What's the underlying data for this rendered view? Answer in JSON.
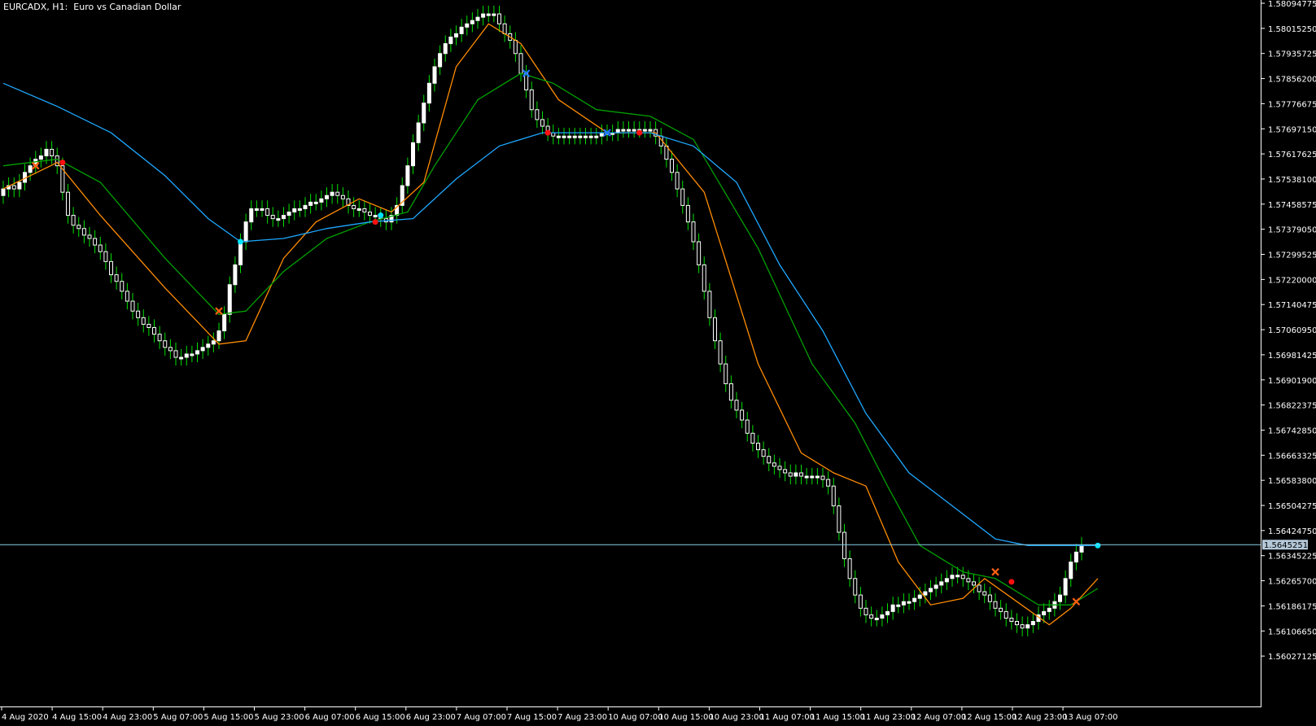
{
  "header": {
    "symbol_line": "EURCADX, H1:  Euro vs Canadian Dollar"
  },
  "colors": {
    "background": "#000000",
    "axis": "#ffffff",
    "candle_body": "#ffffff",
    "candle_wick": "#00e000",
    "bid_line": "#8ad0e8",
    "price_box": "#b4c8d8",
    "ma_fast": "#ff8c00",
    "ma_mid": "#00a000",
    "ma_slow": "#1ea8ff",
    "marker_red": "#ff1010",
    "marker_cyan": "#00e5ff",
    "marker_orange_x": "#ff6010",
    "marker_blue_x": "#1e78ff"
  },
  "chart_data": {
    "type": "candlestick",
    "title": "EURCADX, H1:  Euro vs Canadian Dollar",
    "xlabel": "",
    "ylabel": "",
    "ylim": [
      1.5596,
      1.581
    ],
    "grid": false,
    "y_ticks": [
      "1.58094775",
      "1.58015250",
      "1.57935725",
      "1.57856200",
      "1.57776675",
      "1.57697150",
      "1.57617625",
      "1.57538100",
      "1.57458575",
      "1.57379050",
      "1.57299525",
      "1.57220000",
      "1.57140475",
      "1.57060950",
      "1.56981425",
      "1.56901900",
      "1.56822375",
      "1.56742850",
      "1.56663325",
      "1.56583800",
      "1.56504275",
      "1.56424750",
      "1.56345225",
      "1.56265700",
      "1.56186175",
      "1.56106650",
      "1.56027125"
    ],
    "x_ticks": [
      "4 Aug 2020",
      "4 Aug 15:00",
      "4 Aug 23:00",
      "5 Aug 07:00",
      "5 Aug 15:00",
      "5 Aug 23:00",
      "6 Aug 07:00",
      "6 Aug 15:00",
      "6 Aug 23:00",
      "7 Aug 07:00",
      "7 Aug 15:00",
      "7 Aug 23:00",
      "10 Aug 07:00",
      "10 Aug 15:00",
      "10 Aug 23:00",
      "11 Aug 07:00",
      "11 Aug 15:00",
      "11 Aug 23:00",
      "12 Aug 07:00",
      "12 Aug 15:00",
      "12 Aug 23:00",
      "13 Aug 07:00"
    ],
    "current_price": 1.56452515,
    "current_price_label": "1.56452515",
    "close": [
      1.5753,
      1.5754,
      1.5753,
      1.5755,
      1.5758,
      1.576,
      1.5762,
      1.5763,
      1.5765,
      1.5763,
      1.576,
      1.5752,
      1.5745,
      1.5742,
      1.5741,
      1.5739,
      1.5738,
      1.5736,
      1.5734,
      1.5731,
      1.5727,
      1.5725,
      1.5722,
      1.5719,
      1.5716,
      1.5714,
      1.5712,
      1.5711,
      1.5709,
      1.5707,
      1.5705,
      1.5704,
      1.5702,
      1.5702,
      1.5703,
      1.5703,
      1.5704,
      1.5705,
      1.5706,
      1.5707,
      1.571,
      1.5715,
      1.5724,
      1.573,
      1.5737,
      1.5743,
      1.5747,
      1.5747,
      1.5747,
      1.5745,
      1.5744,
      1.5744,
      1.5745,
      1.5746,
      1.5747,
      1.5747,
      1.5748,
      1.5749,
      1.5749,
      1.575,
      1.5751,
      1.5752,
      1.5751,
      1.575,
      1.5748,
      1.5747,
      1.5747,
      1.5746,
      1.5745,
      1.5745,
      1.5744,
      1.5743,
      1.5745,
      1.5748,
      1.5754,
      1.576,
      1.5767,
      1.5773,
      1.5779,
      1.5785,
      1.579,
      1.5794,
      1.5797,
      1.5799,
      1.58,
      1.5802,
      1.5803,
      1.5804,
      1.5805,
      1.5806,
      1.5806,
      1.5806,
      1.5803,
      1.58,
      1.5798,
      1.5794,
      1.5788,
      1.5783,
      1.5777,
      1.5774,
      1.5772,
      1.577,
      1.5769,
      1.5769,
      1.5769,
      1.5769,
      1.5769,
      1.5769,
      1.5769,
      1.5769,
      1.5769,
      1.577,
      1.577,
      1.577,
      1.5771,
      1.5771,
      1.5771,
      1.5771,
      1.5771,
      1.5771,
      1.5771,
      1.5769,
      1.5766,
      1.5762,
      1.5758,
      1.5753,
      1.5748,
      1.5743,
      1.5737,
      1.573,
      1.5722,
      1.5714,
      1.5707,
      1.57,
      1.5694,
      1.5689,
      1.5686,
      1.5683,
      1.5679,
      1.5676,
      1.5674,
      1.5672,
      1.567,
      1.5669,
      1.5668,
      1.5667,
      1.5666,
      1.5667,
      1.5666,
      1.5666,
      1.5666,
      1.5666,
      1.5665,
      1.5663,
      1.5657,
      1.5649,
      1.5641,
      1.5635,
      1.563,
      1.5626,
      1.5624,
      1.5623,
      1.5623,
      1.5624,
      1.5625,
      1.5627,
      1.5627,
      1.5628,
      1.5628,
      1.5629,
      1.563,
      1.5631,
      1.5632,
      1.5633,
      1.5634,
      1.5635,
      1.5636,
      1.5636,
      1.5635,
      1.5634,
      1.5633,
      1.5631,
      1.563,
      1.5628,
      1.5626,
      1.5625,
      1.5623,
      1.5622,
      1.5621,
      1.562,
      1.5621,
      1.5622,
      1.5624,
      1.5625,
      1.5626,
      1.5628,
      1.563,
      1.5635,
      1.564,
      1.5643,
      1.5645
    ],
    "series": [
      {
        "type": "line",
        "color": "#ff8c00",
        "points": [
          [
            0,
            1.5753
          ],
          [
            10,
            1.5761
          ],
          [
            18,
            1.5745
          ],
          [
            30,
            1.5723
          ],
          [
            40,
            1.5706
          ],
          [
            45,
            1.5707
          ],
          [
            52,
            1.5732
          ],
          [
            58,
            1.5743
          ],
          [
            66,
            1.575
          ],
          [
            72,
            1.5746
          ],
          [
            78,
            1.5755
          ],
          [
            84,
            1.579
          ],
          [
            90,
            1.5803
          ],
          [
            96,
            1.5797
          ],
          [
            103,
            1.578
          ],
          [
            112,
            1.577
          ],
          [
            121,
            1.577
          ],
          [
            130,
            1.5752
          ],
          [
            140,
            1.57
          ],
          [
            148,
            1.5673
          ],
          [
            154,
            1.5667
          ],
          [
            160,
            1.5663
          ],
          [
            166,
            1.564
          ],
          [
            172,
            1.5627
          ],
          [
            178,
            1.5629
          ],
          [
            182,
            1.5635
          ],
          [
            188,
            1.5628
          ],
          [
            194,
            1.5621
          ],
          [
            198,
            1.5626
          ],
          [
            203,
            1.5635
          ]
        ]
      },
      {
        "type": "line",
        "color": "#00a000",
        "points": [
          [
            0,
            1.576
          ],
          [
            10,
            1.5762
          ],
          [
            18,
            1.5755
          ],
          [
            30,
            1.5732
          ],
          [
            40,
            1.5715
          ],
          [
            45,
            1.5716
          ],
          [
            52,
            1.5728
          ],
          [
            60,
            1.5738
          ],
          [
            68,
            1.5743
          ],
          [
            75,
            1.5746
          ],
          [
            80,
            1.576
          ],
          [
            88,
            1.578
          ],
          [
            96,
            1.5788
          ],
          [
            102,
            1.5785
          ],
          [
            110,
            1.5777
          ],
          [
            120,
            1.5775
          ],
          [
            128,
            1.5768
          ],
          [
            140,
            1.5735
          ],
          [
            150,
            1.57
          ],
          [
            158,
            1.5682
          ],
          [
            164,
            1.5663
          ],
          [
            170,
            1.5645
          ],
          [
            178,
            1.5637
          ],
          [
            184,
            1.5635
          ],
          [
            192,
            1.5627
          ],
          [
            198,
            1.5627
          ],
          [
            203,
            1.5632
          ]
        ]
      },
      {
        "type": "line",
        "color": "#1ea8ff",
        "points": [
          [
            0,
            1.5785
          ],
          [
            10,
            1.5778
          ],
          [
            20,
            1.577
          ],
          [
            30,
            1.5757
          ],
          [
            38,
            1.5744
          ],
          [
            44,
            1.5737
          ],
          [
            52,
            1.5738
          ],
          [
            60,
            1.5741
          ],
          [
            68,
            1.5743
          ],
          [
            76,
            1.5744
          ],
          [
            84,
            1.5756
          ],
          [
            92,
            1.5766
          ],
          [
            100,
            1.577
          ],
          [
            110,
            1.577
          ],
          [
            120,
            1.577
          ],
          [
            128,
            1.5766
          ],
          [
            136,
            1.5755
          ],
          [
            144,
            1.573
          ],
          [
            152,
            1.571
          ],
          [
            160,
            1.5685
          ],
          [
            168,
            1.5667
          ],
          [
            176,
            1.5657
          ],
          [
            184,
            1.5647
          ],
          [
            190,
            1.5645
          ],
          [
            203,
            1.5645
          ]
        ]
      }
    ],
    "markers": [
      {
        "kind": "x",
        "color": "#ff6010",
        "x": 6,
        "y": 1.576
      },
      {
        "kind": "dot",
        "color": "#ff1010",
        "x": 11,
        "y": 1.5761
      },
      {
        "kind": "x",
        "color": "#ff6010",
        "x": 40,
        "y": 1.5716
      },
      {
        "kind": "dot",
        "color": "#00e5ff",
        "x": 44,
        "y": 1.5737
      },
      {
        "kind": "dot",
        "color": "#ff1010",
        "x": 69,
        "y": 1.5743
      },
      {
        "kind": "dot",
        "color": "#00e5ff",
        "x": 70,
        "y": 1.5745
      },
      {
        "kind": "x",
        "color": "#1e78ff",
        "x": 97,
        "y": 1.5788
      },
      {
        "kind": "dot",
        "color": "#ff1010",
        "x": 101,
        "y": 1.577
      },
      {
        "kind": "x",
        "color": "#1e78ff",
        "x": 112,
        "y": 1.577
      },
      {
        "kind": "dot",
        "color": "#ff1010",
        "x": 118,
        "y": 1.577
      },
      {
        "kind": "x",
        "color": "#ff6010",
        "x": 184,
        "y": 1.5637
      },
      {
        "kind": "dot",
        "color": "#ff1010",
        "x": 187,
        "y": 1.5634
      },
      {
        "kind": "x",
        "color": "#ff6010",
        "x": 199,
        "y": 1.5628
      },
      {
        "kind": "dot",
        "color": "#00e5ff",
        "x": 203,
        "y": 1.5645
      }
    ]
  }
}
